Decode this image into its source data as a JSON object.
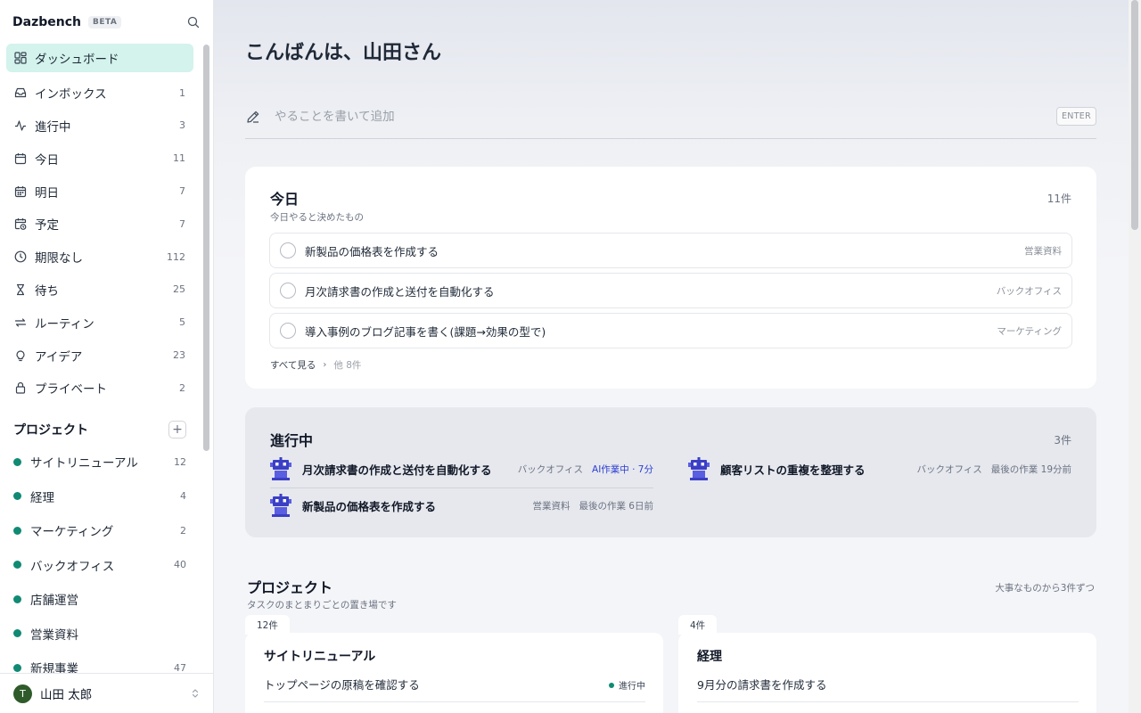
{
  "app": {
    "name": "Dazbench",
    "badge": "BETA"
  },
  "sidebar": {
    "nav": [
      {
        "label": "ダッシュボード",
        "count": "",
        "icon": "dashboard-icon"
      },
      {
        "label": "インボックス",
        "count": "1",
        "icon": "inbox-icon"
      },
      {
        "label": "進行中",
        "count": "3",
        "icon": "activity-icon"
      },
      {
        "label": "今日",
        "count": "11",
        "icon": "calendar-icon"
      },
      {
        "label": "明日",
        "count": "7",
        "icon": "calendar-grid-icon"
      },
      {
        "label": "予定",
        "count": "7",
        "icon": "calendar-clock-icon"
      },
      {
        "label": "期限なし",
        "count": "112",
        "icon": "clock-icon"
      },
      {
        "label": "待ち",
        "count": "25",
        "icon": "hourglass-icon"
      },
      {
        "label": "ルーティン",
        "count": "5",
        "icon": "repeat-icon"
      },
      {
        "label": "アイデア",
        "count": "23",
        "icon": "lightbulb-icon"
      },
      {
        "label": "プライベート",
        "count": "2",
        "icon": "lock-icon"
      }
    ],
    "projects_title": "プロジェクト",
    "projects": [
      {
        "label": "サイトリニューアル",
        "count": "12"
      },
      {
        "label": "経理",
        "count": "4"
      },
      {
        "label": "マーケティング",
        "count": "2"
      },
      {
        "label": "バックオフィス",
        "count": "40"
      },
      {
        "label": "店舗運営",
        "count": ""
      },
      {
        "label": "営業資料",
        "count": ""
      },
      {
        "label": "新規事業",
        "count": "47"
      }
    ],
    "user": {
      "initial": "T",
      "name": "山田 太郎"
    }
  },
  "main": {
    "greeting": "こんばんは、山田さん",
    "quick_add": {
      "placeholder": "やることを書いて追加",
      "enter_hint": "ENTER"
    },
    "today": {
      "title": "今日",
      "count": "11件",
      "subtitle": "今日やると決めたもの",
      "tasks": [
        {
          "title": "新製品の価格表を作成する",
          "tag": "営業資料"
        },
        {
          "title": "月次請求書の作成と送付を自動化する",
          "tag": "バックオフィス"
        },
        {
          "title": "導入事例のブログ記事を書く(課題→効果の型で)",
          "tag": "マーケティング"
        }
      ],
      "see_all": "すべて見る",
      "more": "他 8件"
    },
    "in_progress": {
      "title": "進行中",
      "count": "3件",
      "items": [
        {
          "title": "月次請求書の作成と送付を自動化する",
          "project": "バックオフィス",
          "status": "AI作業中 · 7分"
        },
        {
          "title": "顧客リストの重複を整理する",
          "project": "バックオフィス",
          "status": "最後の作業 19分前"
        },
        {
          "title": "新製品の価格表を作成する",
          "project": "営業資料",
          "status": "最後の作業 6日前"
        }
      ]
    },
    "projects": {
      "title": "プロジェクト",
      "subtitle": "タスクのまとまりごとの置き場です",
      "right_note": "大事なものから3件ずつ",
      "cards": [
        {
          "count": "12件",
          "title": "サイトリニューアル",
          "task": "トップページの原稿を確認する",
          "status": "進行中"
        },
        {
          "count": "4件",
          "title": "経理",
          "task": "9月分の請求書を作成する",
          "status": ""
        }
      ]
    }
  }
}
